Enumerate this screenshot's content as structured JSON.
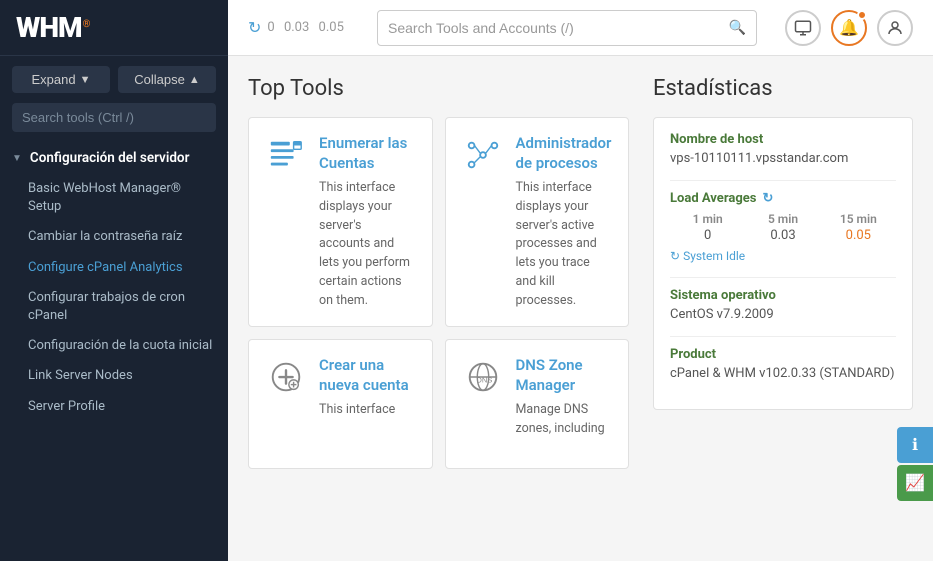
{
  "logo": {
    "text": "WHM",
    "registered": "®"
  },
  "sidebar": {
    "expand_label": "Expand",
    "collapse_label": "Collapse",
    "search_placeholder": "Search tools (Ctrl /)",
    "section_label": "Configuración del servidor",
    "nav_items": [
      "Basic WebHost Manager® Setup",
      "Cambiar la contraseña raíz",
      "Configure cPanel Analytics",
      "Configurar trabajos de cron cPanel",
      "Configuración de la cuota inicial",
      "Link Server Nodes",
      "Server Profile"
    ],
    "footer_label": "Server Profile"
  },
  "topbar": {
    "load1": "0",
    "load5": "0.03",
    "load15": "0.05",
    "search_placeholder": "Search Tools and Accounts (/)",
    "icon_screen": "⊡",
    "icon_bell": "🔔",
    "icon_user": "👤"
  },
  "tools": {
    "title": "Top Tools",
    "items": [
      {
        "name": "Enumerar las Cuentas",
        "desc": "This interface displays your server's accounts and lets you perform certain actions on them.",
        "icon": "list"
      },
      {
        "name": "Administrador de procesos",
        "desc": "This interface displays your server's active processes and lets you trace and kill processes.",
        "icon": "process"
      },
      {
        "name": "Crear una nueva cuenta",
        "desc": "This interface",
        "icon": "add"
      },
      {
        "name": "DNS Zone Manager",
        "desc": "Manage DNS zones, including",
        "icon": "dns"
      }
    ]
  },
  "stats": {
    "title": "Estadísticas",
    "hostname_label": "Nombre de host",
    "hostname_value": "vps-10110111.vpsstandar.com",
    "load_avg_label": "Load Averages",
    "load_1min_label": "1 min",
    "load_5min_label": "5 min",
    "load_15min_label": "15 min",
    "load_1min_val": "0",
    "load_5min_val": "0.03",
    "load_15min_val": "0.05",
    "system_idle": "System Idle",
    "os_label": "Sistema operativo",
    "os_value": "CentOS v7.9.2009",
    "product_label": "Product",
    "product_value": "cPanel & WHM v102.0.33 (STANDARD)"
  }
}
